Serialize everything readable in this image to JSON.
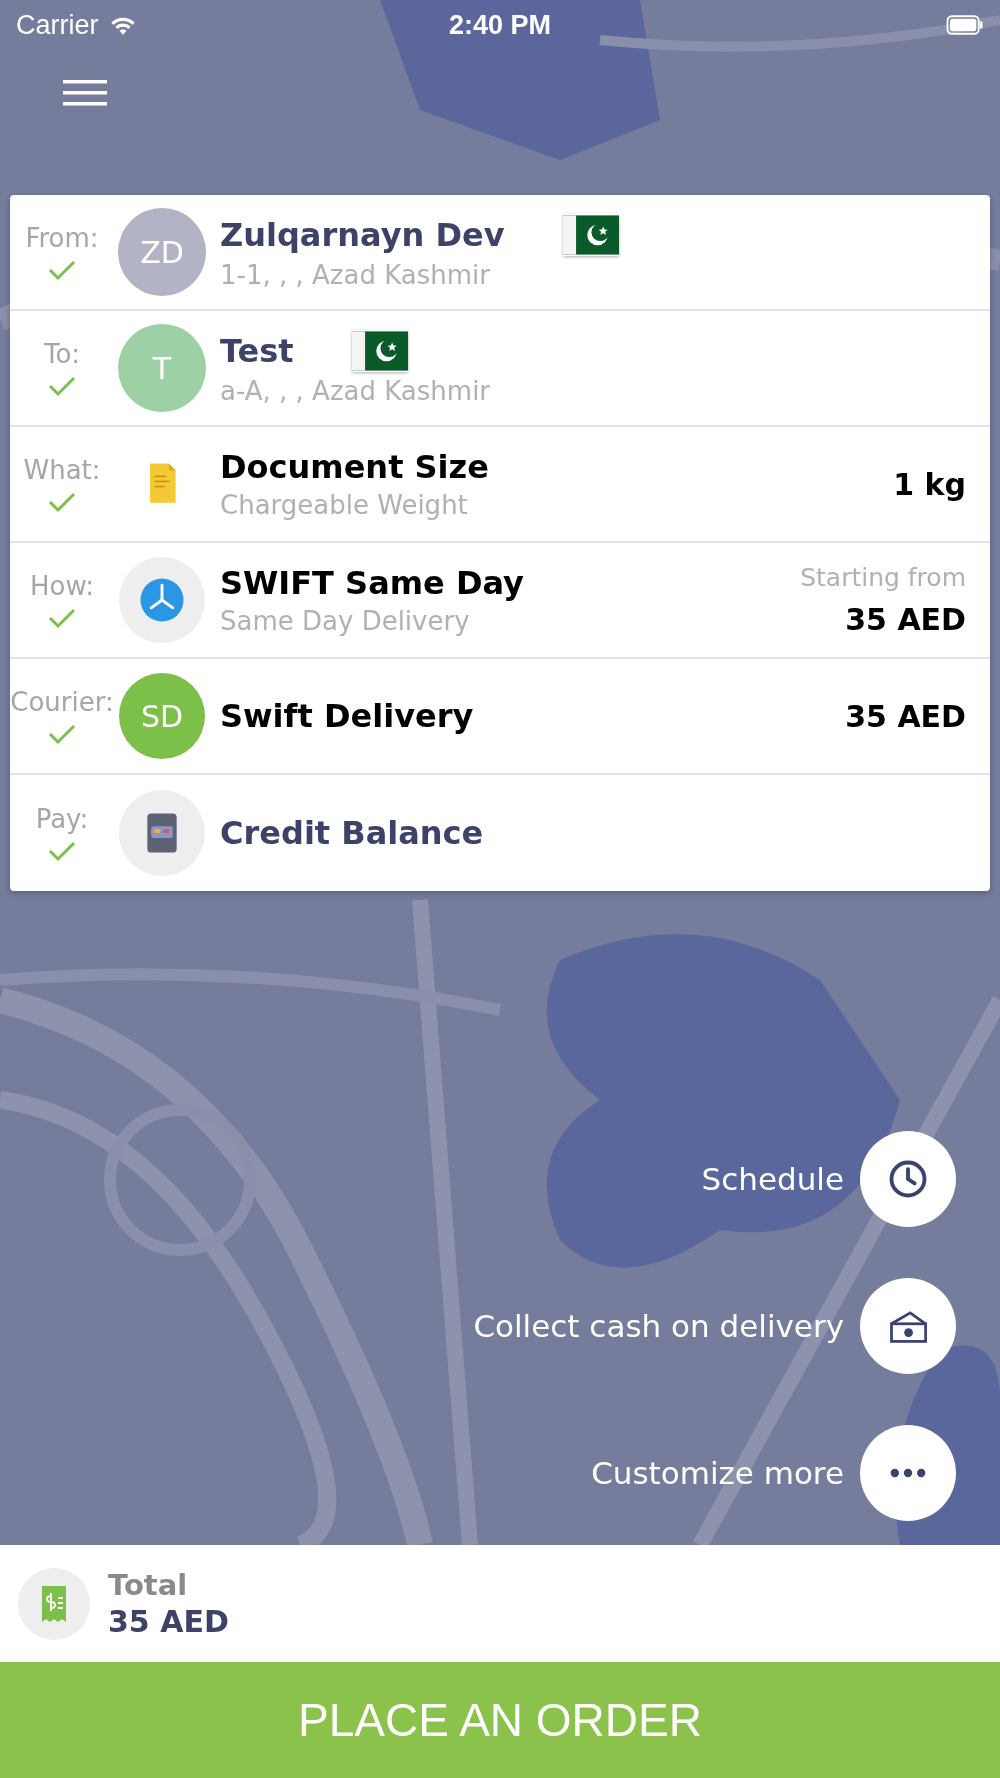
{
  "status_bar": {
    "carrier": "Carrier",
    "time": "2:40 PM"
  },
  "rows": [
    {
      "kind": "contact",
      "label": "From:",
      "checked": true,
      "initials": "ZD",
      "color": "#b3b3c6",
      "title": "Zulqarnayn Dev",
      "subtitle": "1-1, , , Azad Kashmir"
    },
    {
      "kind": "contact",
      "label": "To:",
      "checked": true,
      "initials": "T",
      "color": "#9ed0a6",
      "title": "Test",
      "subtitle": "a-A, , , Azad Kashmir"
    },
    {
      "kind": "package",
      "label": "What:",
      "checked": true,
      "title": "Document Size",
      "subtitle": "Chargeable Weight",
      "value": "1 kg"
    },
    {
      "kind": "service",
      "label": "How:",
      "checked": true,
      "title": "SWIFT Same Day",
      "subtitle": "Same Day Delivery",
      "note": "Starting from",
      "value": "35 AED"
    },
    {
      "kind": "courier",
      "label": "Courier:",
      "checked": true,
      "initials": "SD",
      "color": "#7cc04a",
      "title": "Swift Delivery",
      "value": "35 AED"
    },
    {
      "kind": "payment",
      "label": "Pay:",
      "checked": true,
      "title": "Credit Balance"
    }
  ],
  "actions": [
    {
      "kind": "schedule",
      "label": "Schedule"
    },
    {
      "kind": "cash",
      "label": "Collect cash on delivery"
    },
    {
      "kind": "more",
      "label": "Customize more"
    }
  ],
  "total": {
    "label": "Total",
    "amount": "35 AED"
  },
  "order_button": "PLACE AN ORDER"
}
